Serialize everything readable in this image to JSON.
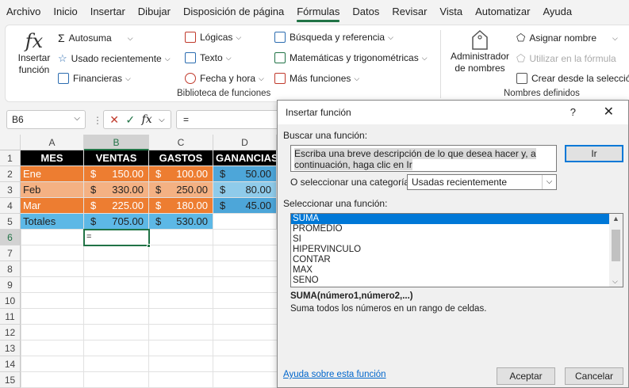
{
  "menu": [
    "Archivo",
    "Inicio",
    "Insertar",
    "Dibujar",
    "Disposición de página",
    "Fórmulas",
    "Datos",
    "Revisar",
    "Vista",
    "Automatizar",
    "Ayuda"
  ],
  "ribbon": {
    "insert_function": "Insertar función",
    "autosum": "Autosuma",
    "recent": "Usado recientemente",
    "financial": "Financieras",
    "logical": "Lógicas",
    "text": "Texto",
    "datetime": "Fecha y hora",
    "lookup": "Búsqueda y referencia",
    "math": "Matemáticas y trigonométricas",
    "more": "Más funciones",
    "library_label": "Biblioteca de funciones",
    "name_manager": "Administrador de nombres",
    "define_name": "Asignar nombre",
    "use_in_formula": "Utilizar en la fórmula",
    "create_from_selection": "Crear desde la selección",
    "names_label": "Nombres definidos"
  },
  "formula_bar": {
    "name_box": "B6",
    "formula": "="
  },
  "sheet": {
    "columns": [
      "A",
      "B",
      "C",
      "D"
    ],
    "rows": [
      "1",
      "2",
      "3",
      "4",
      "5",
      "6",
      "7",
      "8",
      "9",
      "10",
      "11",
      "12",
      "13",
      "14",
      "15"
    ],
    "headers": [
      "MES",
      "VENTAS",
      "GASTOS",
      "GANANCIAS"
    ],
    "data": [
      {
        "mes": "Ene",
        "ventas": "150.00",
        "gastos": "100.00",
        "ganancias": "50.00"
      },
      {
        "mes": "Feb",
        "ventas": "330.00",
        "gastos": "250.00",
        "ganancias": "80.00"
      },
      {
        "mes": "Mar",
        "ventas": "225.00",
        "gastos": "180.00",
        "ganancias": "45.00"
      }
    ],
    "totals": {
      "label": "Totales",
      "ventas": "705.00",
      "gastos": "530.00"
    },
    "currency": "$",
    "active_cell_value": "="
  },
  "dialog": {
    "title": "Insertar función",
    "help_mark": "?",
    "search_label": "Buscar una función:",
    "search_text": "Escriba una breve descripción de lo que desea hacer y, a continuación, haga clic en Ir",
    "go": "Ir",
    "category_label": "O seleccionar una categoría:",
    "category_value": "Usadas recientemente",
    "select_label": "Seleccionar una función:",
    "functions": [
      "SUMA",
      "PROMEDIO",
      "SI",
      "HIPERVINCULO",
      "CONTAR",
      "MAX",
      "SENO"
    ],
    "selected_function": "SUMA",
    "signature": "SUMA(número1,número2,...)",
    "description": "Suma todos los números en un rango de celdas.",
    "help_link": "Ayuda sobre esta función",
    "ok": "Aceptar",
    "cancel": "Cancelar"
  }
}
